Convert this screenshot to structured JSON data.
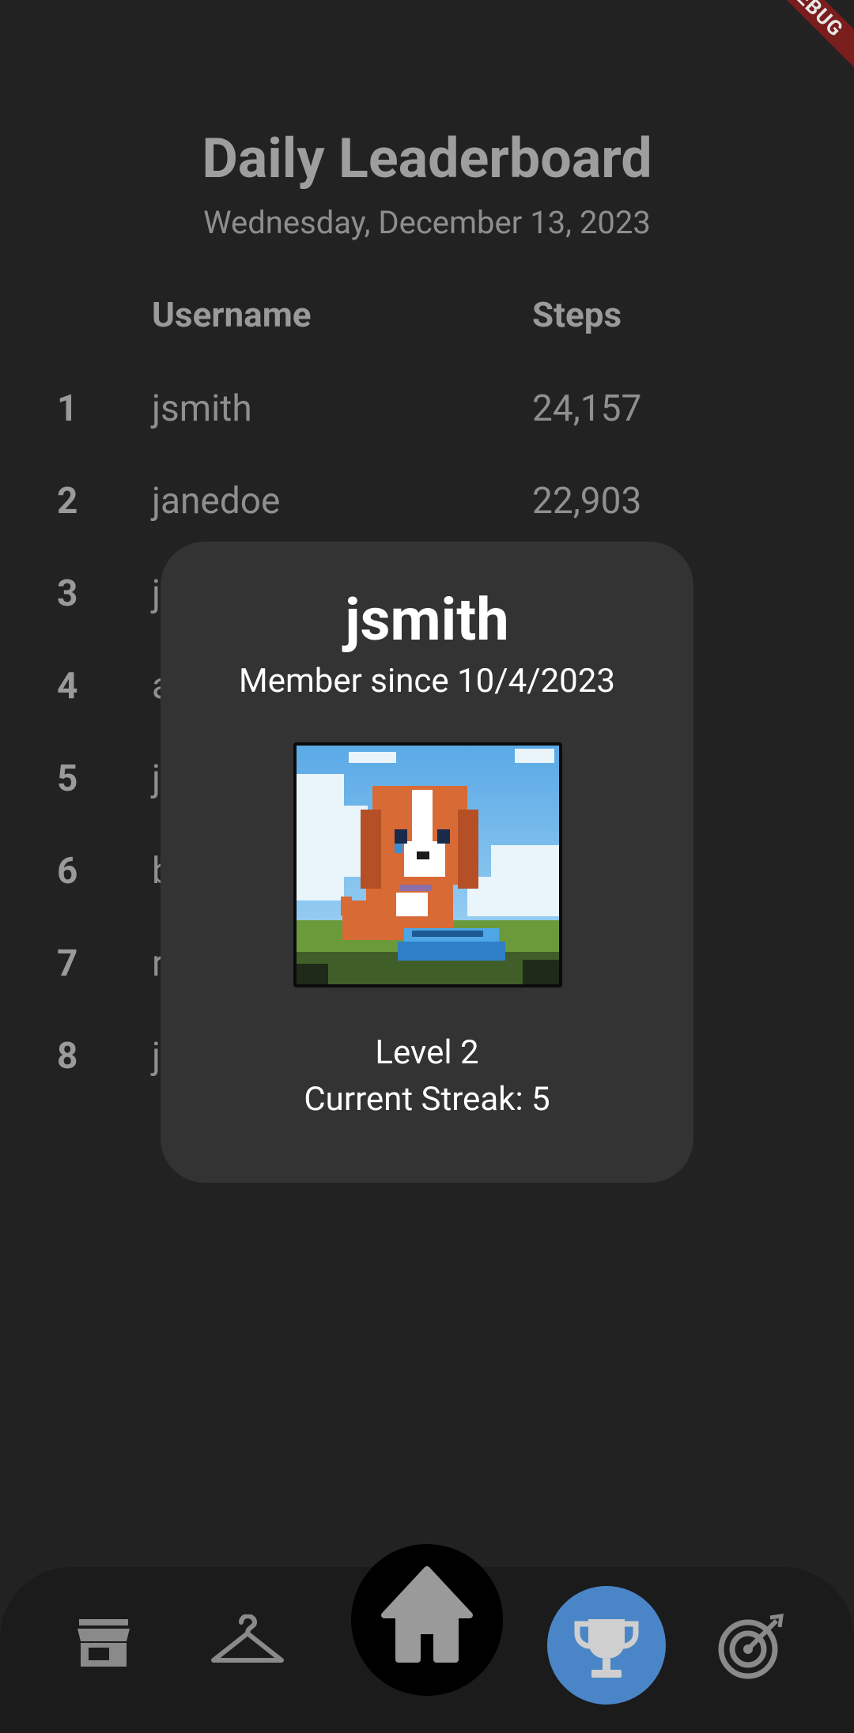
{
  "debug_banner": "DEBUG",
  "header": {
    "title": "Daily Leaderboard",
    "date": "Wednesday, December 13, 2023"
  },
  "table": {
    "columns": [
      "Username",
      "Steps"
    ],
    "rows": [
      {
        "rank": "1",
        "username": "jsmith",
        "steps": "24,157"
      },
      {
        "rank": "2",
        "username": "janedoe",
        "steps": "22,903"
      },
      {
        "rank": "3",
        "username": "j",
        "steps": ""
      },
      {
        "rank": "4",
        "username": "a",
        "steps": ""
      },
      {
        "rank": "5",
        "username": "j",
        "steps": ""
      },
      {
        "rank": "6",
        "username": "b",
        "steps": ""
      },
      {
        "rank": "7",
        "username": "r",
        "steps": ""
      },
      {
        "rank": "8",
        "username": "j",
        "steps": ""
      }
    ]
  },
  "profile_popup": {
    "username": "jsmith",
    "member_since": "Member since 10/4/2023",
    "avatar_icon": "pixel-dog-avatar",
    "level": "Level 2",
    "streak": "Current Streak: 5"
  },
  "bottom_nav": {
    "items": [
      {
        "icon": "store-icon",
        "active": false
      },
      {
        "icon": "hanger-icon",
        "active": false
      },
      {
        "icon": "home-icon",
        "active": false
      },
      {
        "icon": "trophy-icon",
        "active": true
      },
      {
        "icon": "target-icon",
        "active": false
      }
    ],
    "active_color": "#4a86c7"
  },
  "colors": {
    "background": "#222223",
    "popup": "#333334",
    "muted_text": "#9a9a9a"
  }
}
